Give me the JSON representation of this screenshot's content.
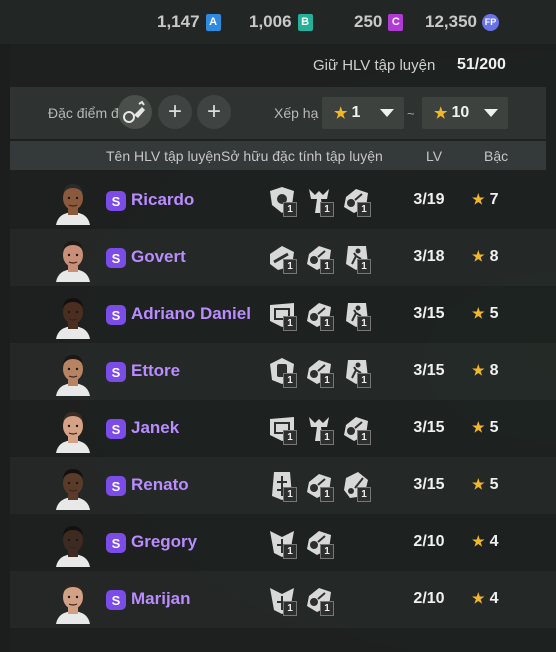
{
  "currencies": [
    {
      "value": "1,147",
      "tag": "A",
      "color": "#2e8be0"
    },
    {
      "value": "1,006",
      "tag": "B",
      "color": "#24b09a"
    },
    {
      "value": "250",
      "tag": "C",
      "color": "#b23ad4"
    },
    {
      "value": "12,350",
      "tag": "FP",
      "color": "#6a72e8"
    }
  ],
  "capacity": {
    "label": "Giữ HLV tập luyện",
    "value": "51/200"
  },
  "filters": {
    "traits_label": "Đặc điểm đ",
    "rank_label": "Xếp hạ",
    "rank_min": "1",
    "rank_max": "10",
    "separator": "~"
  },
  "columns": {
    "name": "Tên HLV tập luyện",
    "traits": "Sở hữu đặc tính tập luyện",
    "lv": "LV",
    "grade": "Bậc"
  },
  "coaches": [
    {
      "name": "Ricardo",
      "lv": "3/19",
      "grade": "7",
      "traits": [
        {
          "icon": "shield-ball-icon",
          "level": "1"
        },
        {
          "icon": "defender-icon",
          "level": "1"
        },
        {
          "icon": "kick-ball-icon",
          "level": "1"
        }
      ],
      "skin": "#8a5a3c",
      "hair": "#2a2a2a"
    },
    {
      "name": "Govert",
      "lv": "3/18",
      "grade": "8",
      "traits": [
        {
          "icon": "sliding-tackle-icon",
          "level": "1"
        },
        {
          "icon": "kick-ball-icon",
          "level": "1"
        },
        {
          "icon": "sprint-icon",
          "level": "1"
        }
      ],
      "skin": "#c99077",
      "hair": "#1e1a16"
    },
    {
      "name": "Adriano Daniel",
      "lv": "3/15",
      "grade": "5",
      "traits": [
        {
          "icon": "goal-net-icon",
          "level": "1"
        },
        {
          "icon": "kick-ball-icon",
          "level": "1"
        },
        {
          "icon": "sprint-icon",
          "level": "1"
        }
      ],
      "skin": "#4a2e1f",
      "hair": "#151010"
    },
    {
      "name": "Ettore",
      "lv": "3/15",
      "grade": "8",
      "traits": [
        {
          "icon": "goalkeeper-icon",
          "level": "1"
        },
        {
          "icon": "kick-ball-icon",
          "level": "1"
        },
        {
          "icon": "sprint-icon",
          "level": "1"
        }
      ],
      "skin": "#b78463",
      "hair": "#1c1712"
    },
    {
      "name": "Janek",
      "lv": "3/15",
      "grade": "5",
      "traits": [
        {
          "icon": "goal-net-icon",
          "level": "1"
        },
        {
          "icon": "defender-icon",
          "level": "1"
        },
        {
          "icon": "kick-ball-icon",
          "level": "1"
        }
      ],
      "skin": "#d6a286",
      "hair": "#3a2c22"
    },
    {
      "name": "Renato",
      "lv": "3/15",
      "grade": "5",
      "traits": [
        {
          "icon": "strength-icon",
          "level": "1"
        },
        {
          "icon": "kick-ball-icon",
          "level": "1"
        },
        {
          "icon": "dribble-icon",
          "level": "1"
        }
      ],
      "skin": "#5a3a28",
      "hair": "#141010"
    },
    {
      "name": "Gregory",
      "lv": "2/10",
      "grade": "4",
      "traits": [
        {
          "icon": "jump-header-icon",
          "level": "1"
        },
        {
          "icon": "kick-ball-icon",
          "level": "1"
        }
      ],
      "skin": "#3d2a20",
      "hair": "#111"
    },
    {
      "name": "Marijan",
      "lv": "2/10",
      "grade": "4",
      "traits": [
        {
          "icon": "jump-header-icon",
          "level": "1"
        },
        {
          "icon": "kick-ball-icon",
          "level": "1"
        }
      ],
      "skin": "#d2a084",
      "hair": "#2e2620"
    }
  ]
}
